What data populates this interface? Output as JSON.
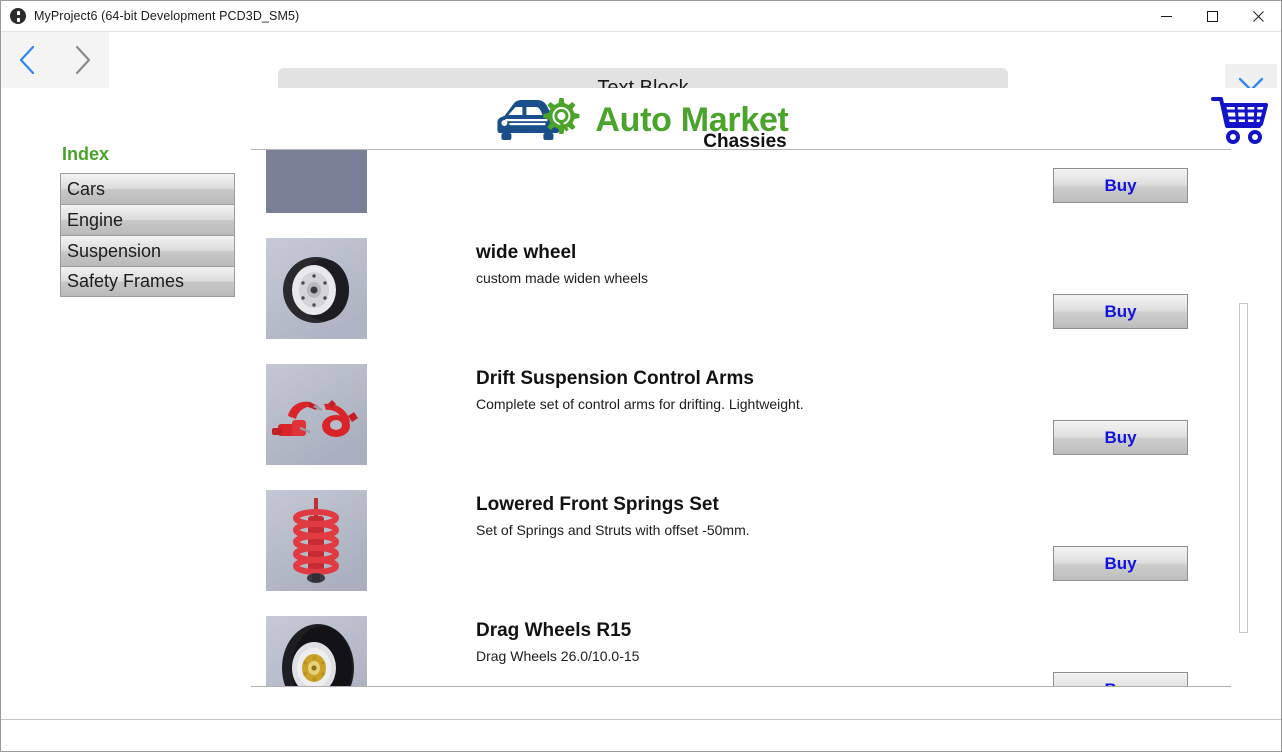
{
  "window": {
    "title": "MyProject6 (64-bit Development PCD3D_SM5)",
    "app_icon": "unreal-engine-icon",
    "controls": {
      "minimize": "minimize-icon",
      "maximize": "maximize-icon",
      "close": "close-icon"
    }
  },
  "toolbar": {
    "back_icon": "chevron-left-icon",
    "forward_icon": "chevron-right-icon",
    "back_enabled_color": "#2e86f0",
    "forward_disabled_color": "#8a8a8a",
    "header_title": "Text Block",
    "close_icon": "close-x-icon",
    "close_icon_color": "#2e86f0"
  },
  "brand": {
    "name": "Auto Market",
    "subtitle": "Chassies",
    "name_color": "#4aa32a",
    "logo_icon": "car-gear-logo-icon",
    "car_color": "#1a4e8a",
    "gear_color": "#4aa32a",
    "cart_icon": "shopping-cart-icon",
    "cart_color": "#1313c8"
  },
  "index": {
    "title": "Index",
    "title_color": "#4aa32a",
    "items": [
      {
        "label": "Cars"
      },
      {
        "label": "Engine"
      },
      {
        "label": "Suspension"
      },
      {
        "label": "Safety Frames"
      }
    ]
  },
  "products": {
    "buy_label": "Buy",
    "buy_color": "#1313e0",
    "items": [
      {
        "name": "",
        "description": "",
        "thumb_icon": "product-image-partial",
        "buy_label": "Buy"
      },
      {
        "name": "wide wheel",
        "description": "custom made widen wheels",
        "thumb_icon": "wheel-image",
        "buy_label": "Buy"
      },
      {
        "name": "Drift Suspension Control Arms",
        "description": "Complete set of control arms for drifting. Lightweight.",
        "thumb_icon": "control-arms-image",
        "buy_label": "Buy"
      },
      {
        "name": "Lowered Front Springs Set",
        "description": "Set of Springs and Struts with offset -50mm.",
        "thumb_icon": "coil-spring-image",
        "buy_label": "Buy"
      },
      {
        "name": "Drag Wheels R15",
        "description": "Drag Wheels 26.0/10.0-15",
        "thumb_icon": "drag-wheel-image",
        "buy_label": "Buy"
      }
    ]
  },
  "scrollbar": {
    "name": "product-list-scrollbar"
  }
}
